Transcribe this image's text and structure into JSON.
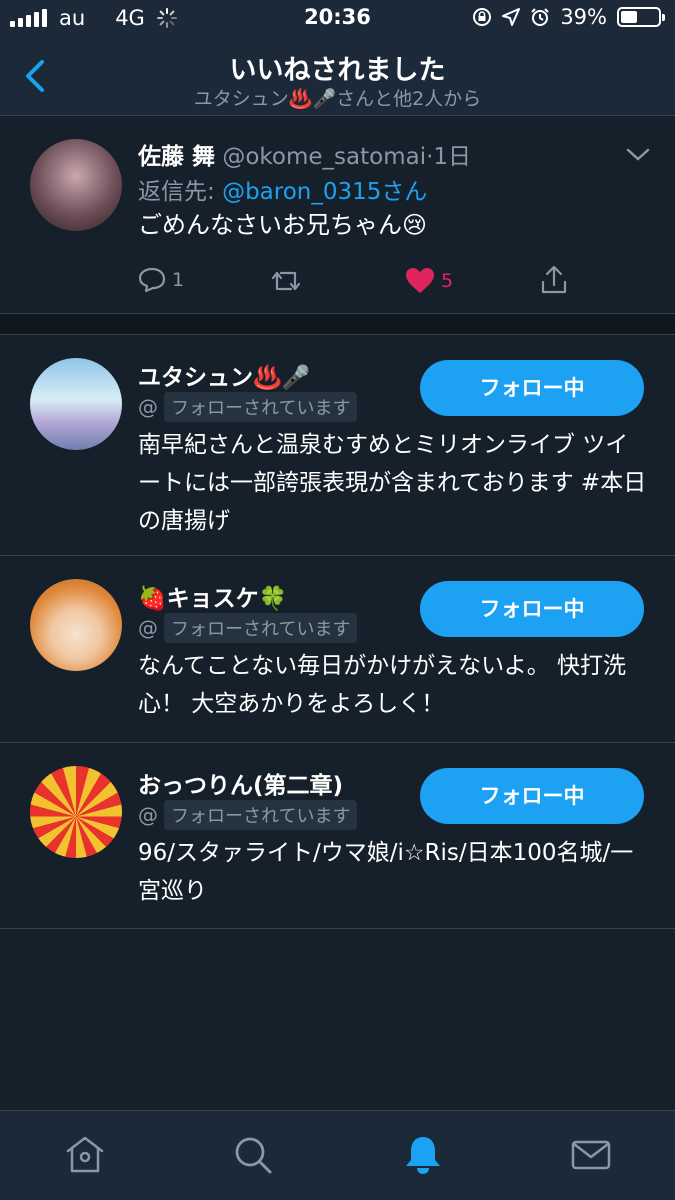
{
  "status": {
    "carrier": "au",
    "network": "4G",
    "time": "20:36",
    "battery": "39%"
  },
  "header": {
    "title": "いいねされました",
    "subtitle": "ユタシュン♨️🎤さんと他2人から"
  },
  "tweet": {
    "name": "佐藤 舞",
    "handle": "@okome_satomai",
    "time": "·1日",
    "reply_prefix": "返信先: ",
    "reply_to": "@baron_0315さん",
    "text": "ごめんなさいお兄ちゃん😢",
    "reply_count": "1",
    "like_count": "5"
  },
  "users": [
    {
      "name": "ユタシュン♨️🎤",
      "handle_prefix": "@",
      "follows_you": "フォローされています",
      "follow_label": "フォロー中",
      "bio": "南早紀さんと温泉むすめとミリオンライブ ツイートには一部誇張表現が含まれております #本日の唐揚げ"
    },
    {
      "name": "🍓キョスケ🍀",
      "handle_prefix": "@",
      "follows_you": "フォローされています",
      "follow_label": "フォロー中",
      "bio": "なんてことない毎日がかけがえないよ。 快打洗心！ 大空あかりをよろしく！"
    },
    {
      "name": "おっつりん(第二章)",
      "handle_prefix": "@",
      "follows_you": "フォローされています",
      "follow_label": "フォロー中",
      "bio": "96/スタァライト/ウマ娘/i☆Ris/日本100名城/一宮巡り"
    }
  ],
  "colors": {
    "background": "#15202b",
    "accent": "#1da1f2",
    "like": "#e0245e",
    "muted": "#8899a6"
  },
  "tabs": [
    "home-icon",
    "search-icon",
    "notifications-icon",
    "messages-icon"
  ]
}
